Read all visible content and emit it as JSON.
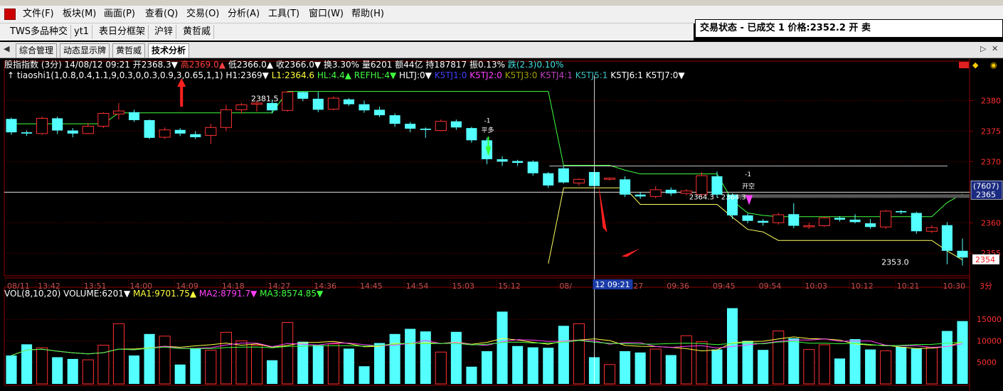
{
  "menu": [
    "文件(F)",
    "板块(M)",
    "画面(P)",
    "查看(Q)",
    "交易(O)",
    "分析(A)",
    "工具(T)",
    "窗口(W)",
    "帮助(H)"
  ],
  "toolbar": [
    "TWS多品种交",
    "yt1",
    "表日分框架",
    "沪锌",
    "黄哲威"
  ],
  "trade_status": "交易状态 - 已成交 1 价格:2352.2 开 卖",
  "tabs": [
    "综合管理",
    "动态显示牌",
    "黄哲威",
    "技术分析"
  ],
  "quote_line": [
    {
      "text": "股指指数 (3分) 14/08/12 09:21",
      "color": "#ffffff"
    },
    {
      "text": "开2368.3▼",
      "color": "#ffffff"
    },
    {
      "text": "高2369.0▲",
      "color": "#ff4040"
    },
    {
      "text": "低2366.0▲",
      "color": "#ffffff"
    },
    {
      "text": "收2366.0▼",
      "color": "#ffffff"
    },
    {
      "text": "换3.30%",
      "color": "#ffffff"
    },
    {
      "text": "量6201",
      "color": "#ffffff"
    },
    {
      "text": "额44亿",
      "color": "#ffffff"
    },
    {
      "text": "持187817",
      "color": "#ffffff"
    },
    {
      "text": "振0.13%",
      "color": "#ffffff"
    },
    {
      "text": "跌(2.3)0.10%",
      "color": "#40e0e0"
    }
  ],
  "indicator_line": [
    {
      "text": "↑ tiaoshi1(1,0.8,0.4,1.1,9,0.3,0,0.3,0.9,3,0.65,1,1)",
      "color": "#ffffff"
    },
    {
      "text": "H1:2369▼",
      "color": "#ffffff"
    },
    {
      "text": "L1:2364.6",
      "color": "#ffff40"
    },
    {
      "text": "HL:4.4▲",
      "color": "#40ff40"
    },
    {
      "text": "REFHL:4▼",
      "color": "#40ff40"
    },
    {
      "text": "HLTJ:0▼",
      "color": "#ffffff"
    },
    {
      "text": "K5TJ1:0",
      "color": "#4040ff"
    },
    {
      "text": "K5TJ2:0",
      "color": "#ff40ff"
    },
    {
      "text": "K5TJ3:0",
      "color": "#a0a000"
    },
    {
      "text": "K5TJ4:1",
      "color": "#c040c0"
    },
    {
      "text": "K5TJ5:1",
      "color": "#40c0c0"
    },
    {
      "text": "K5TJ6:1",
      "color": "#ffffff"
    },
    {
      "text": "K5TJ7:0▼",
      "color": "#ffffff"
    }
  ],
  "vol_line": [
    {
      "text": "VOL(8,10,20)",
      "color": "#ffffff"
    },
    {
      "text": "VOLUME:6201▼",
      "color": "#ffffff"
    },
    {
      "text": "MA1:9701.75▲",
      "color": "#ffff40"
    },
    {
      "text": "MA2:8791.7▼",
      "color": "#ff40ff"
    },
    {
      "text": "MA3:8574.85▼",
      "color": "#40ff40"
    }
  ],
  "axis_labels": {
    "price_ticks": [
      "2380",
      "2375",
      "2370",
      "2365",
      "2360",
      "2355"
    ],
    "vol_ticks": [
      "15000",
      "10000",
      "5000"
    ],
    "time_ticks": [
      "08/11",
      "13:42",
      "13:51",
      "14:00",
      "14:09",
      "14:18",
      "14:27",
      "14:36",
      "14:45",
      "14:54",
      "15:03",
      "15:12",
      "08/",
      "09:27",
      "09:36",
      "09:45",
      "09:54",
      "10:03",
      "10:12",
      "10:21",
      "10:30"
    ],
    "period": "3分",
    "cursor_time": "12 09:21",
    "cursor_price": "2365",
    "cursor_count": "(7607)",
    "last_price": "2354"
  },
  "annotations": {
    "high_label": "2381.5",
    "low_label": "2353.0",
    "mid_label": "2364.3 - 2364.3",
    "signal1_top": "-1",
    "signal1_text": "平多",
    "signal2_top": "-1",
    "signal2_text": "开空"
  },
  "colors": {
    "up": "#ff3030",
    "down": "#54ffff",
    "h_line": "#40ff40",
    "l_line": "#ffff60",
    "grid": "#8b0000"
  },
  "chart_data": {
    "type": "candlestick",
    "period": "3分",
    "bars": [
      {
        "time": "08/11",
        "o": 2377.0,
        "h": 2377.2,
        "c": 2374.8,
        "l": 2374.4,
        "v": 6600
      },
      {
        "time": "13:39",
        "o": 2374.8,
        "h": 2375.1,
        "c": 2374.6,
        "l": 2374.2,
        "v": 9200
      },
      {
        "time": "13:42",
        "o": 2374.6,
        "h": 2377.4,
        "c": 2377.1,
        "l": 2374.4,
        "v": 8400
      },
      {
        "time": "13:45",
        "o": 2377.1,
        "h": 2377.4,
        "c": 2375.1,
        "l": 2374.5,
        "v": 6200
      },
      {
        "time": "13:48",
        "o": 2375.1,
        "h": 2375.5,
        "c": 2374.6,
        "l": 2374.0,
        "v": 5800
      },
      {
        "time": "13:51",
        "o": 2374.6,
        "h": 2376.3,
        "c": 2375.8,
        "l": 2374.5,
        "v": 5600
      },
      {
        "time": "13:54",
        "o": 2375.8,
        "h": 2378.1,
        "c": 2377.9,
        "l": 2375.5,
        "v": 9000
      },
      {
        "time": "13:57",
        "o": 2377.8,
        "h": 2379.6,
        "c": 2378.3,
        "l": 2376.9,
        "v": 14000
      },
      {
        "time": "14:00",
        "o": 2378.1,
        "h": 2378.5,
        "c": 2376.8,
        "l": 2376.5,
        "v": 6600
      },
      {
        "time": "14:03",
        "o": 2376.8,
        "h": 2376.9,
        "c": 2373.9,
        "l": 2373.7,
        "v": 11600
      },
      {
        "time": "14:06",
        "o": 2374.0,
        "h": 2375.6,
        "c": 2375.2,
        "l": 2373.7,
        "v": 11100
      },
      {
        "time": "14:09",
        "o": 2375.2,
        "h": 2375.5,
        "c": 2374.6,
        "l": 2374.2,
        "v": 4500
      },
      {
        "time": "14:12",
        "o": 2374.5,
        "h": 2375.0,
        "c": 2374.0,
        "l": 2373.7,
        "v": 8300
      },
      {
        "time": "14:15",
        "o": 2374.3,
        "h": 2376.2,
        "c": 2375.6,
        "l": 2372.9,
        "v": 7800
      },
      {
        "time": "14:18",
        "o": 2375.6,
        "h": 2379.3,
        "c": 2378.5,
        "l": 2375.0,
        "v": 12000
      },
      {
        "time": "14:21",
        "o": 2378.5,
        "h": 2379.6,
        "c": 2379.3,
        "l": 2377.9,
        "v": 10000
      },
      {
        "time": "14:24",
        "o": 2379.4,
        "h": 2380.0,
        "c": 2379.6,
        "l": 2378.2,
        "v": 9000
      },
      {
        "time": "14:27",
        "o": 2379.6,
        "h": 2380.2,
        "c": 2378.4,
        "l": 2377.9,
        "v": 5500
      },
      {
        "time": "14:30",
        "o": 2378.4,
        "h": 2381.5,
        "c": 2381.4,
        "l": 2378.2,
        "v": 14300
      },
      {
        "time": "14:33",
        "o": 2381.4,
        "h": 2381.5,
        "c": 2380.3,
        "l": 2379.9,
        "v": 9800
      },
      {
        "time": "14:36",
        "o": 2380.3,
        "h": 2381.4,
        "c": 2378.5,
        "l": 2378.1,
        "v": 9000
      },
      {
        "time": "14:39",
        "o": 2378.6,
        "h": 2380.7,
        "c": 2380.4,
        "l": 2378.4,
        "v": 9300
      },
      {
        "time": "14:42",
        "o": 2380.2,
        "h": 2380.4,
        "c": 2379.4,
        "l": 2379.1,
        "v": 8200
      },
      {
        "time": "14:45",
        "o": 2379.4,
        "h": 2380.0,
        "c": 2378.4,
        "l": 2378.0,
        "v": 4100
      },
      {
        "time": "14:48",
        "o": 2378.5,
        "h": 2379.0,
        "c": 2377.6,
        "l": 2377.3,
        "v": 9500
      },
      {
        "time": "14:51",
        "o": 2377.6,
        "h": 2377.9,
        "c": 2376.2,
        "l": 2375.7,
        "v": 11600
      },
      {
        "time": "14:54",
        "o": 2376.2,
        "h": 2376.5,
        "c": 2375.4,
        "l": 2374.8,
        "v": 12800
      },
      {
        "time": "14:57",
        "o": 2375.4,
        "h": 2375.6,
        "c": 2375.2,
        "l": 2373.9,
        "v": 12200
      },
      {
        "time": "15:00",
        "o": 2375.1,
        "h": 2376.9,
        "c": 2376.6,
        "l": 2375.0,
        "v": 7400
      },
      {
        "time": "15:03",
        "o": 2376.6,
        "h": 2376.9,
        "c": 2375.6,
        "l": 2375.2,
        "v": 12100
      },
      {
        "time": "15:06",
        "o": 2375.5,
        "h": 2375.7,
        "c": 2373.5,
        "l": 2373.1,
        "v": 4000
      },
      {
        "time": "15:09",
        "o": 2373.5,
        "h": 2373.9,
        "c": 2370.4,
        "l": 2369.6,
        "v": 7600
      },
      {
        "time": "15:12",
        "o": 2370.4,
        "h": 2370.9,
        "c": 2370.0,
        "l": 2369.3,
        "v": 16800
      },
      {
        "time": "15:15",
        "o": 2370.1,
        "h": 2370.3,
        "c": 2369.8,
        "l": 2369.3,
        "v": 8800
      },
      {
        "time": "15:18",
        "o": 2370.0,
        "h": 2370.2,
        "c": 2368.1,
        "l": 2367.7,
        "v": 8500
      },
      {
        "time": "15:21",
        "o": 2368.1,
        "h": 2368.3,
        "c": 2366.1,
        "l": 2365.7,
        "v": 8400
      },
      {
        "time": "08/12 09:15",
        "o": 2368.9,
        "h": 2369.2,
        "c": 2366.6,
        "l": 2366.4,
        "v": 13500
      },
      {
        "time": "09:18",
        "o": 2366.5,
        "h": 2367.3,
        "c": 2367.1,
        "l": 2366.1,
        "v": 14000
      },
      {
        "time": "09:21",
        "o": 2368.3,
        "h": 2369.0,
        "c": 2366.0,
        "l": 2366.0,
        "v": 6201
      },
      {
        "time": "09:24",
        "o": 2367.1,
        "h": 2367.4,
        "c": 2367.3,
        "l": 2366.9,
        "v": 4500
      },
      {
        "time": "09:27",
        "o": 2367.1,
        "h": 2367.6,
        "c": 2364.6,
        "l": 2364.2,
        "v": 7600
      },
      {
        "time": "09:30",
        "o": 2364.6,
        "h": 2365.0,
        "c": 2364.3,
        "l": 2363.9,
        "v": 7300
      },
      {
        "time": "09:33",
        "o": 2364.3,
        "h": 2366.0,
        "c": 2365.4,
        "l": 2364.0,
        "v": 8100
      },
      {
        "time": "09:36",
        "o": 2365.4,
        "h": 2365.8,
        "c": 2364.8,
        "l": 2364.4,
        "v": 6700
      },
      {
        "time": "09:39",
        "o": 2364.8,
        "h": 2365.5,
        "c": 2365.2,
        "l": 2364.5,
        "v": 11200
      },
      {
        "time": "09:42",
        "o": 2364.6,
        "h": 2368.3,
        "c": 2367.7,
        "l": 2364.2,
        "v": 9800
      },
      {
        "time": "09:45",
        "o": 2367.6,
        "h": 2368.4,
        "c": 2364.6,
        "l": 2364.1,
        "v": 8000
      },
      {
        "time": "09:48",
        "o": 2364.6,
        "h": 2364.8,
        "c": 2361.2,
        "l": 2360.6,
        "v": 17600
      },
      {
        "time": "09:51",
        "o": 2361.2,
        "h": 2361.5,
        "c": 2360.3,
        "l": 2359.9,
        "v": 10000
      },
      {
        "time": "09:54",
        "o": 2360.3,
        "h": 2360.6,
        "c": 2360.0,
        "l": 2359.5,
        "v": 7900
      },
      {
        "time": "09:57",
        "o": 2360.0,
        "h": 2361.6,
        "c": 2361.3,
        "l": 2359.7,
        "v": 12300
      },
      {
        "time": "10:00",
        "o": 2361.4,
        "h": 2363.2,
        "c": 2359.5,
        "l": 2359.1,
        "v": 10600
      },
      {
        "time": "10:03",
        "o": 2359.5,
        "h": 2360.0,
        "c": 2359.5,
        "l": 2359.0,
        "v": 8000
      },
      {
        "time": "10:06",
        "o": 2359.5,
        "h": 2361.0,
        "c": 2360.8,
        "l": 2359.3,
        "v": 9100
      },
      {
        "time": "10:09",
        "o": 2360.8,
        "h": 2361.1,
        "c": 2360.5,
        "l": 2360.2,
        "v": 5900
      },
      {
        "time": "10:12",
        "o": 2360.5,
        "h": 2361.4,
        "c": 2360.1,
        "l": 2359.9,
        "v": 10400
      },
      {
        "time": "10:15",
        "o": 2359.9,
        "h": 2360.6,
        "c": 2359.3,
        "l": 2359.0,
        "v": 8000
      },
      {
        "time": "10:18",
        "o": 2359.3,
        "h": 2362.1,
        "c": 2361.9,
        "l": 2359.0,
        "v": 7700
      },
      {
        "time": "10:21",
        "o": 2361.9,
        "h": 2362.1,
        "c": 2361.7,
        "l": 2361.4,
        "v": 8600
      },
      {
        "time": "10:24",
        "o": 2361.6,
        "h": 2361.8,
        "c": 2358.6,
        "l": 2358.2,
        "v": 8200
      },
      {
        "time": "10:27",
        "o": 2358.6,
        "h": 2359.6,
        "c": 2359.2,
        "l": 2358.3,
        "v": 8500
      },
      {
        "time": "10:30",
        "o": 2359.6,
        "h": 2360.1,
        "c": 2355.4,
        "l": 2353.2,
        "v": 12300
      },
      {
        "time": "10:33",
        "o": 2355.4,
        "h": 2357.4,
        "c": 2354.3,
        "l": 2353.0,
        "v": 14600
      }
    ],
    "h_line": [
      2376.2,
      2376.2,
      2376.2,
      2376.2,
      2376.2,
      2376.2,
      2376.2,
      2378.0,
      2378.0,
      2378.0,
      2378.0,
      2378.0,
      2378.0,
      2378.0,
      2378.0,
      2378.0,
      2378.0,
      2378.0,
      2381.5,
      2381.5,
      2381.5,
      2381.5,
      2381.5,
      2381.5,
      2381.5,
      2381.5,
      2381.5,
      2381.5,
      2381.5,
      2381.5,
      2381.5,
      2381.5,
      2381.5,
      2381.5,
      2381.5,
      2381.5,
      2369.4,
      2369.4,
      2369.4,
      2369.4,
      2368.6,
      2368.0,
      2368.0,
      2368.0,
      2368.0,
      2368.0,
      2368.0,
      2363.6,
      2361.6,
      2361.2,
      2361.0,
      2361.0,
      2361.0,
      2361.0,
      2361.0,
      2361.0,
      2361.0,
      2361.0,
      2361.0,
      2361.0,
      2361.0,
      2363.3,
      2364.7
    ],
    "l_line": [
      null,
      null,
      null,
      null,
      null,
      null,
      null,
      null,
      null,
      null,
      null,
      null,
      null,
      null,
      null,
      null,
      null,
      null,
      null,
      null,
      null,
      null,
      null,
      null,
      null,
      null,
      null,
      null,
      null,
      null,
      null,
      null,
      null,
      null,
      null,
      2353.3,
      2365.7,
      2365.7,
      2365.7,
      2365.7,
      2365.7,
      2363.0,
      2363.0,
      2363.0,
      2363.0,
      2363.0,
      2363.0,
      2360.9,
      2358.9,
      2358.5,
      2357.1,
      2357.1,
      2357.1,
      2357.1,
      2357.1,
      2357.1,
      2357.1,
      2357.1,
      2357.1,
      2357.1,
      2357.1,
      2355.4,
      2353.9
    ],
    "price_range": [
      2351.3,
      2383.2
    ],
    "vol_range": [
      0,
      19500
    ]
  }
}
